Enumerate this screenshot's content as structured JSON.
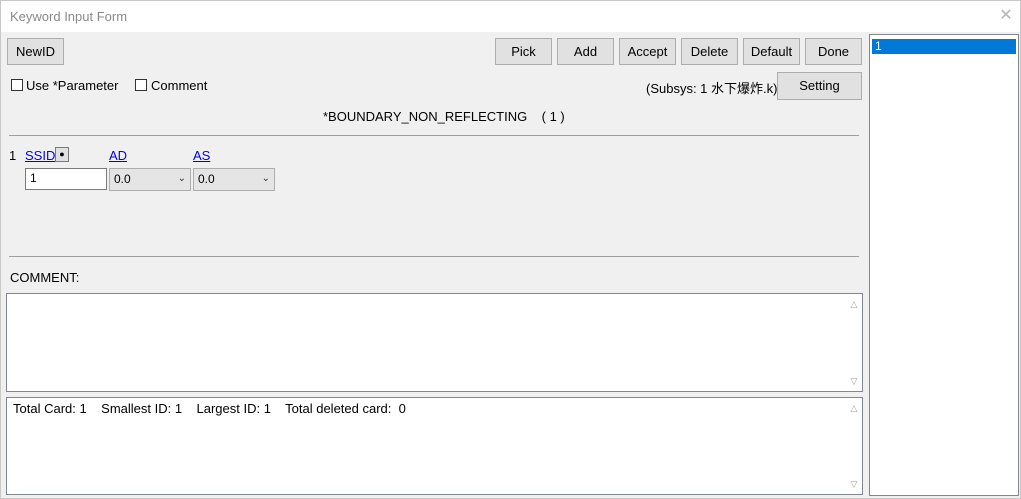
{
  "window": {
    "title": "Keyword Input Form",
    "close_glyph": "✕"
  },
  "toolbar": {
    "newid_label": "NewID",
    "pick_label": "Pick",
    "add_label": "Add",
    "accept_label": "Accept",
    "delete_label": "Delete",
    "default_label": "Default",
    "done_label": "Done"
  },
  "options": {
    "use_parameter_label": "Use *Parameter",
    "comment_label": "Comment",
    "subsys_text": "(Subsys: 1 水下爆炸.k)",
    "setting_label": "Setting"
  },
  "keyword": {
    "heading": "*BOUNDARY_NON_REFLECTING    ( 1 )"
  },
  "card": {
    "row_number": "1",
    "fields": [
      {
        "name": "SSID",
        "value": "1"
      },
      {
        "name": "AD",
        "value": "0.0"
      },
      {
        "name": "AS",
        "value": "0.0"
      }
    ],
    "pick_glyph": "●"
  },
  "comment": {
    "label": "COMMENT:",
    "text": ""
  },
  "status": {
    "text": "Total Card: 1    Smallest ID: 1    Largest ID: 1    Total deleted card:  0"
  },
  "id_list": {
    "items": [
      "1"
    ]
  },
  "colors": {
    "selection": "#0078d7",
    "link": "#0000ee",
    "dialog_bg": "#f0f0f0"
  }
}
